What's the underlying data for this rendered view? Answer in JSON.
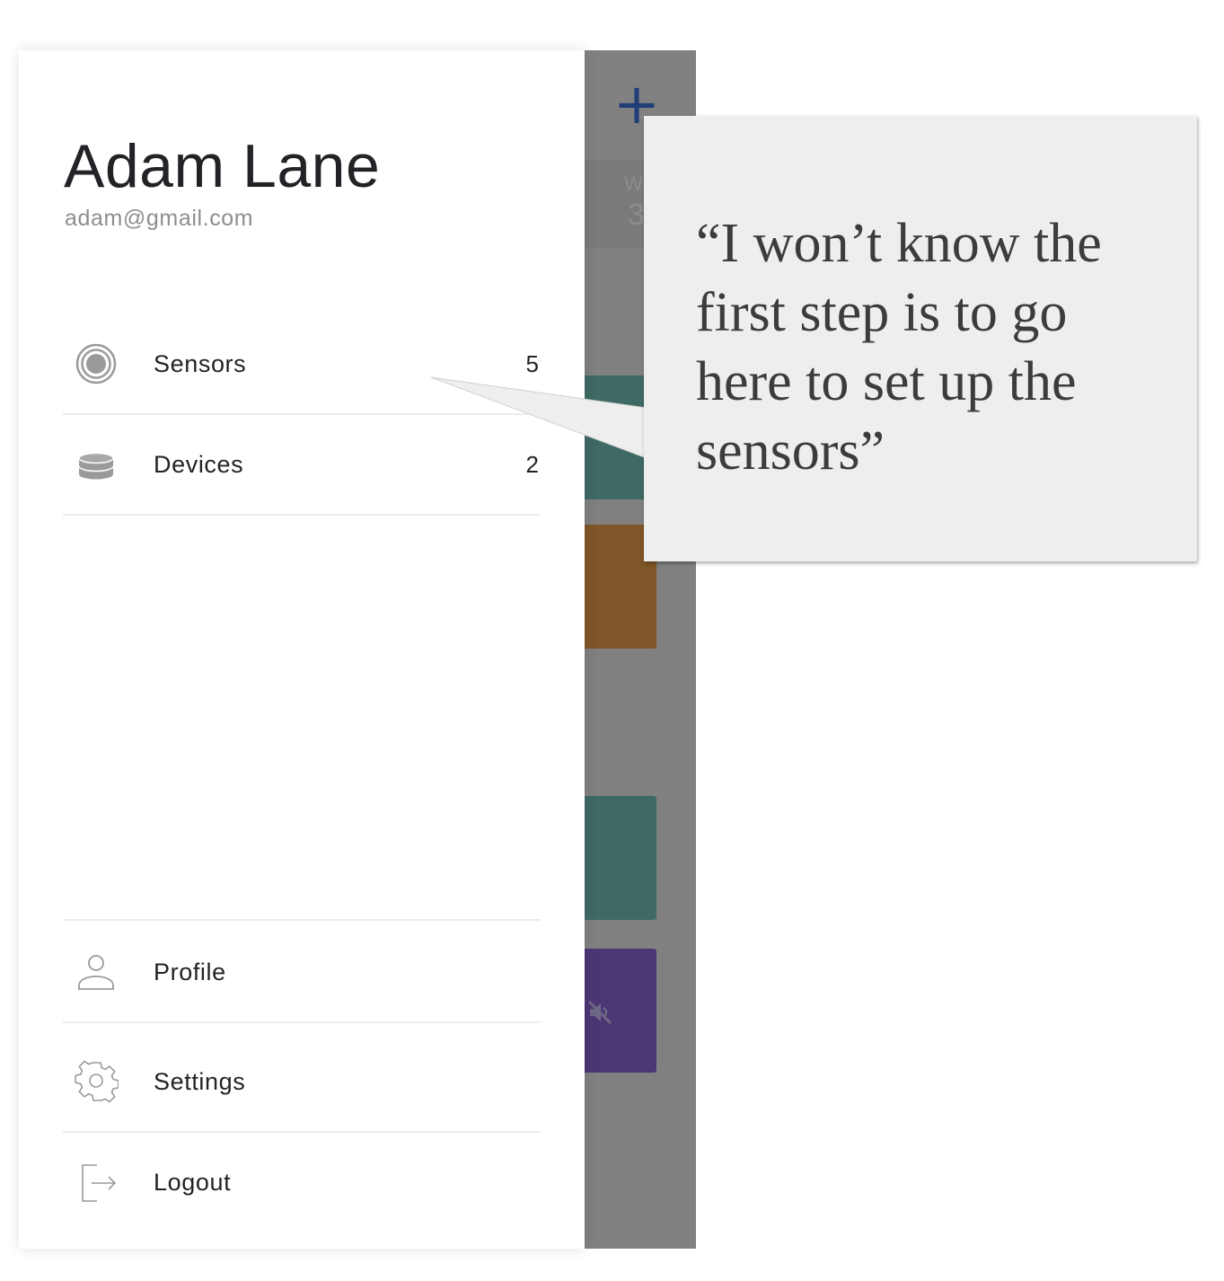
{
  "user": {
    "name": "Adam Lane",
    "email": "adam@gmail.com"
  },
  "nav": {
    "items": [
      {
        "label": "Sensors",
        "count": "5",
        "icon": "sensor-icon"
      },
      {
        "label": "Devices",
        "count": "2",
        "icon": "device-stack-icon"
      }
    ],
    "bottom_items": [
      {
        "label": "Profile",
        "icon": "person-icon"
      },
      {
        "label": "Settings",
        "icon": "gear-icon"
      },
      {
        "label": "Logout",
        "icon": "logout-icon"
      }
    ]
  },
  "background_app": {
    "add_button": "+",
    "stat_label": "W",
    "stat_value": "3",
    "card_colors": [
      "#3e6a63",
      "#7f5627",
      "#3e6a63",
      "#4b3775"
    ]
  },
  "callout": {
    "quote": "“I won’t know the first step is to go here to set up the sensors”"
  },
  "colors": {
    "overlay": "#808080",
    "accent": "#223e78",
    "text": "#232323",
    "muted": "#8e8e8e"
  }
}
